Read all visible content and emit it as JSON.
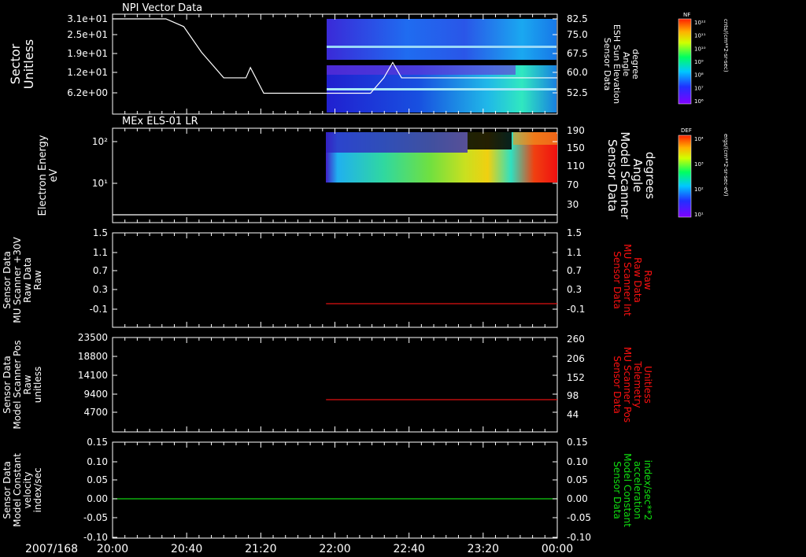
{
  "colors": {
    "background": "#000000",
    "axis": "#ffffff",
    "trace_white": "#ffffff",
    "trace_red": "#e01010",
    "trace_green": "#10d010",
    "label_red": "#ff1010",
    "label_green": "#10e010"
  },
  "time_axis": {
    "date_label": "2007/168",
    "ticks": [
      "20:00",
      "20:40",
      "21:20",
      "22:00",
      "22:40",
      "23:20",
      "00:00"
    ]
  },
  "chart_data": [
    {
      "type": "line",
      "title": "NPI Vector Data",
      "ylabel": [
        "Sector",
        "Unitless"
      ],
      "yticks": [
        "3.1e+01",
        "2.5e+01",
        "1.9e+01",
        "1.2e+01",
        "6.2e+00"
      ],
      "right_label": [
        "Sensor Data",
        "ESH Sun Elevation",
        "Angle",
        "degree"
      ],
      "right_ticks": [
        "82.5",
        "75.0",
        "67.5",
        "60.0",
        "52.5"
      ],
      "ylim_right": [
        45,
        82.5
      ],
      "spectrogram": "NF cnts/(cm**2-sr-sec)",
      "series": [
        {
          "x": [
            0,
            0.12,
            0.16,
            0.2,
            0.25,
            0.28,
            0.3,
            0.31,
            0.34,
            0.54,
            0.58,
            0.61,
            0.63,
            0.65,
            1.0
          ],
          "y": [
            31,
            31,
            28,
            18,
            8,
            8,
            8,
            12,
            2,
            2,
            2,
            8,
            14,
            8,
            8
          ]
        }
      ],
      "ylim": [
        0,
        31
      ]
    },
    {
      "type": "line",
      "title": "MEx ELS-01 LR",
      "ylabel": [
        "Electron Energy",
        "eV"
      ],
      "yticks": [
        "10²",
        "10¹"
      ],
      "right_label": [
        "Sensor Data",
        "Model Scanner",
        "Angle",
        "degrees"
      ],
      "right_ticks": [
        "190",
        "150",
        "110",
        "70",
        "30"
      ],
      "ylim_right": [
        0,
        190
      ],
      "spectrogram": "DEF ergs/(cm**2-sr-sec-eV)",
      "series": [
        {
          "x": [
            0,
            1
          ],
          "y": [
            4,
            4
          ]
        }
      ]
    },
    {
      "type": "line",
      "ylabel": [
        "Sensor Data",
        "MU Scanner +30V",
        "Raw Data",
        "Raw"
      ],
      "yticks": [
        "1.5",
        "1.1",
        "0.7",
        "0.3",
        "-0.1"
      ],
      "right_label": [
        "Sensor Data",
        "MU Scanner Int",
        "Raw Data",
        "Raw"
      ],
      "right_ticks": [
        "1.5",
        "1.1",
        "0.7",
        "0.3",
        "-0.1"
      ],
      "ylim": [
        -0.5,
        1.5
      ],
      "series": [
        {
          "x": [
            0.48,
            1
          ],
          "y": [
            0.0,
            0.0
          ]
        }
      ]
    },
    {
      "type": "line",
      "ylabel": [
        "Sensor Data",
        "Model Scanner Pos",
        "Raw",
        "unitless"
      ],
      "yticks": [
        "23500",
        "18800",
        "14100",
        "9400",
        "4700"
      ],
      "right_label": [
        "Sensor Data",
        "MU Scanner Pos",
        "Telemetry",
        "Unitless"
      ],
      "right_ticks": [
        "260",
        "206",
        "152",
        "98",
        "44"
      ],
      "ylim_right": [
        -10,
        260
      ],
      "series": [
        {
          "x": [
            0.48,
            1
          ],
          "y": [
            82,
            82
          ]
        }
      ]
    },
    {
      "type": "line",
      "ylabel": [
        "Sensor Data",
        "Model Constant",
        "velocity",
        "index/sec"
      ],
      "yticks": [
        "0.15",
        "0.10",
        "0.05",
        "0.00",
        "-0.05",
        "-0.10"
      ],
      "right_label": [
        "Sensor Data",
        "Model Constant",
        "acceleration",
        "index/sec**2"
      ],
      "right_ticks": [
        "0.15",
        "0.10",
        "0.05",
        "0.00",
        "-0.05",
        "-0.10"
      ],
      "ylim": [
        -0.1,
        0.15
      ],
      "series": [
        {
          "x": [
            0,
            1
          ],
          "y": [
            0.0,
            0.0
          ]
        }
      ]
    }
  ],
  "colorbars": [
    {
      "title": "NF",
      "units": "cnts/(cm**2-sr-sec)",
      "ticks": [
        "10¹²",
        "10¹¹",
        "10¹⁰",
        "10⁹",
        "10⁸",
        "10⁷",
        "10⁶"
      ]
    },
    {
      "title": "DEF",
      "units": "ergs/(cm**2-sr-sec-eV)",
      "ticks": [
        "10⁴",
        "10³",
        "10²",
        "10¹"
      ]
    }
  ]
}
